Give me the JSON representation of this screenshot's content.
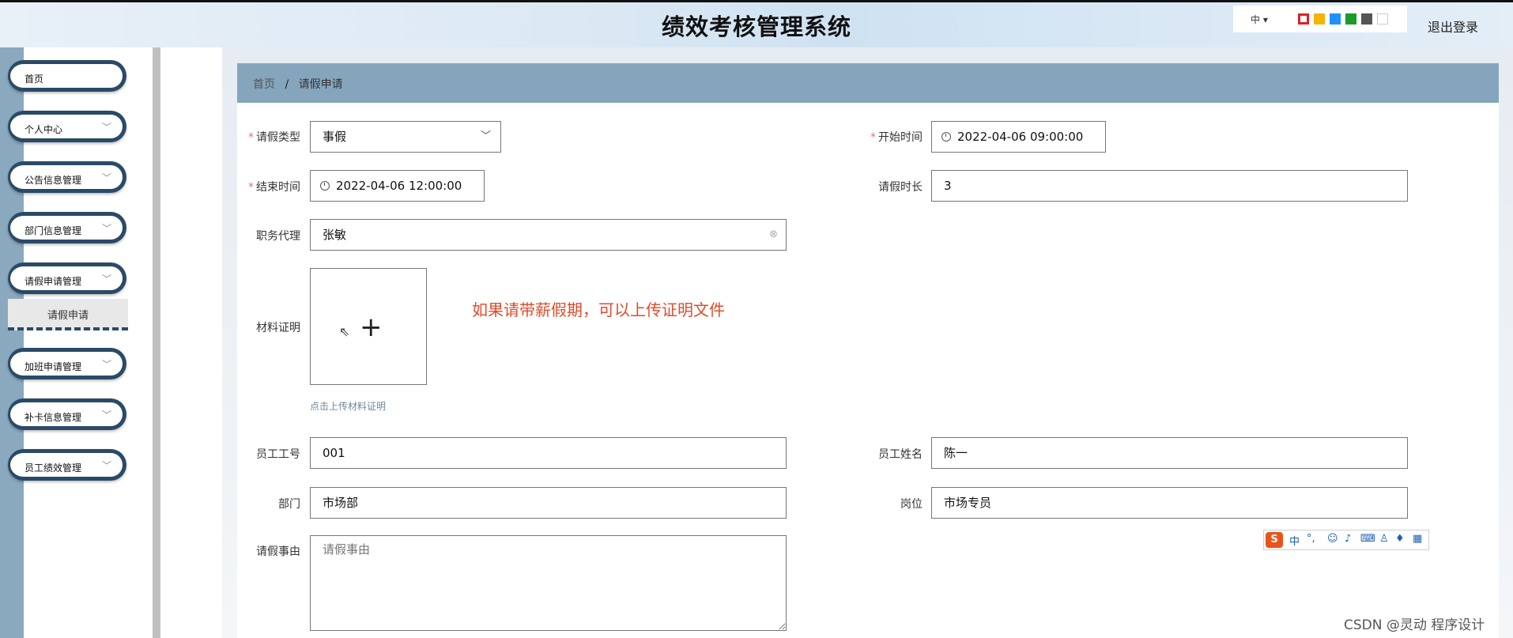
{
  "header": {
    "title": "绩效考核管理系统",
    "lang": "中 ▾",
    "logout": "退出登录",
    "theme_colors": [
      "#e02020",
      "#f5b400",
      "#1e90ff",
      "#1a9b2a",
      "#555555",
      "#ffffff"
    ]
  },
  "sidebar": {
    "items": [
      {
        "label": "首页"
      },
      {
        "label": "个人中心"
      },
      {
        "label": "公告信息管理"
      },
      {
        "label": "部门信息管理"
      },
      {
        "label": "请假申请管理"
      },
      {
        "label": "加班申请管理"
      },
      {
        "label": "补卡信息管理"
      },
      {
        "label": "员工绩效管理"
      }
    ],
    "sub_item": "请假申请"
  },
  "breadcrumb": {
    "home": "首页",
    "sep": "/",
    "current": "请假申请"
  },
  "form": {
    "leave_type_label": "请假类型",
    "leave_type_value": "事假",
    "start_label": "开始时间",
    "start_value": "2022-04-06 09:00:00",
    "end_label": "结束时间",
    "end_value": "2022-04-06 12:00:00",
    "duration_label": "请假时长",
    "duration_value": "3",
    "agent_label": "职务代理",
    "agent_value": "张敏",
    "material_label": "材料证明",
    "upload_hint": "点击上传材料证明",
    "note": "如果请带薪假期，可以上传证明文件",
    "emp_no_label": "员工工号",
    "emp_no_value": "001",
    "emp_name_label": "员工姓名",
    "emp_name_value": "陈一",
    "dept_label": "部门",
    "dept_value": "市场部",
    "post_label": "岗位",
    "post_value": "市场专员",
    "reason_label": "请假事由",
    "reason_placeholder": "请假事由"
  },
  "ime": {
    "lang": "中"
  },
  "watermark": "CSDN @灵动 程序设计"
}
